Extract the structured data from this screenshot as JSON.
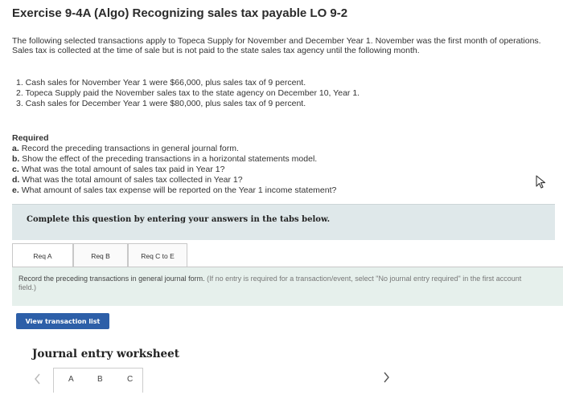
{
  "exercise": {
    "title": "Exercise 9-4A (Algo) Recognizing sales tax payable LO 9-2",
    "intro": "The following selected transactions apply to Topeca Supply for November and December Year 1. November was the first month of operations. Sales tax is collected at the time of sale but is not paid to the state sales tax agency until the following month.",
    "transactions": [
      "1. Cash sales for November Year 1 were $66,000, plus sales tax of 9 percent.",
      "2. Topeca Supply paid the November sales tax to the state agency on December 10, Year 1.",
      "3. Cash sales for December Year 1 were $80,000, plus sales tax of 9 percent."
    ]
  },
  "required": {
    "heading": "Required",
    "items": [
      {
        "letter": "a.",
        "text": "Record the preceding transactions in general journal form."
      },
      {
        "letter": "b.",
        "text": "Show the effect of the preceding transactions in a horizontal statements model."
      },
      {
        "letter": "c.",
        "text": "What was the total amount of sales tax paid in Year 1?"
      },
      {
        "letter": "d.",
        "text": "What was the total amount of sales tax collected in Year 1?"
      },
      {
        "letter": "e.",
        "text": "What amount of sales tax expense will be reported on the Year 1 income statement?"
      }
    ]
  },
  "instruction_box": {
    "text": "Complete this question by entering your answers in the tabs below."
  },
  "tabs": [
    {
      "label": "Req A"
    },
    {
      "label": "Req B"
    },
    {
      "label": "Req C to E"
    }
  ],
  "tab_panel": {
    "instruction": "Record the preceding transactions in general journal form.",
    "note": "(If no entry is required for a transaction/event, select \"No journal entry required\" in the first account field.)"
  },
  "buttons": {
    "view_transaction_list": "View transaction list"
  },
  "worksheet": {
    "title": "Journal entry worksheet",
    "pages": [
      "A",
      "B",
      "C"
    ]
  },
  "icons": {
    "cursor": "mouse-pointer-icon",
    "prev": "chevron-left-icon",
    "next": "chevron-right-icon"
  },
  "colors": {
    "instruction_bg": "#dfe8ea",
    "panel_bg": "#e6f0ec",
    "button_bg": "#2d5fa8"
  }
}
